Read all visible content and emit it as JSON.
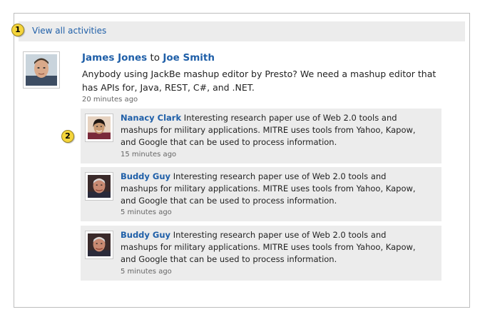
{
  "top": {
    "callout_1": "1",
    "view_all_label": "View all activities"
  },
  "main_activity": {
    "author": "James Jones",
    "connector": "to",
    "recipient": "Joe Smith",
    "message": "Anybody using JackBe mashup editor by Presto? We need a mashup editor that has APIs for, Java, REST, C#, and .NET.",
    "time": "20 minutes ago"
  },
  "replies_callout": "2",
  "replies": [
    {
      "author": "Nanacy Clark",
      "message": "Interesting research paper use of Web 2.0 tools and mashups for military applications. MITRE uses tools from Yahoo, Kapow, and Google that can be used to process information.",
      "time": "15 minutes ago"
    },
    {
      "author": "Buddy Guy",
      "message": "Interesting research paper use of Web 2.0 tools and mashups for military applications. MITRE uses tools from Yahoo, Kapow, and Google that can be used to process information.",
      "time": "5 minutes ago"
    },
    {
      "author": "Buddy Guy",
      "message": "Interesting research paper use of Web 2.0 tools and mashups for military applications. MITRE uses tools from Yahoo, Kapow, and Google that can be used to process information.",
      "time": "5 minutes ago"
    }
  ],
  "colors": {
    "link": "#1f5fa8",
    "callout": "#f5d53b",
    "panel": "#ececec"
  }
}
